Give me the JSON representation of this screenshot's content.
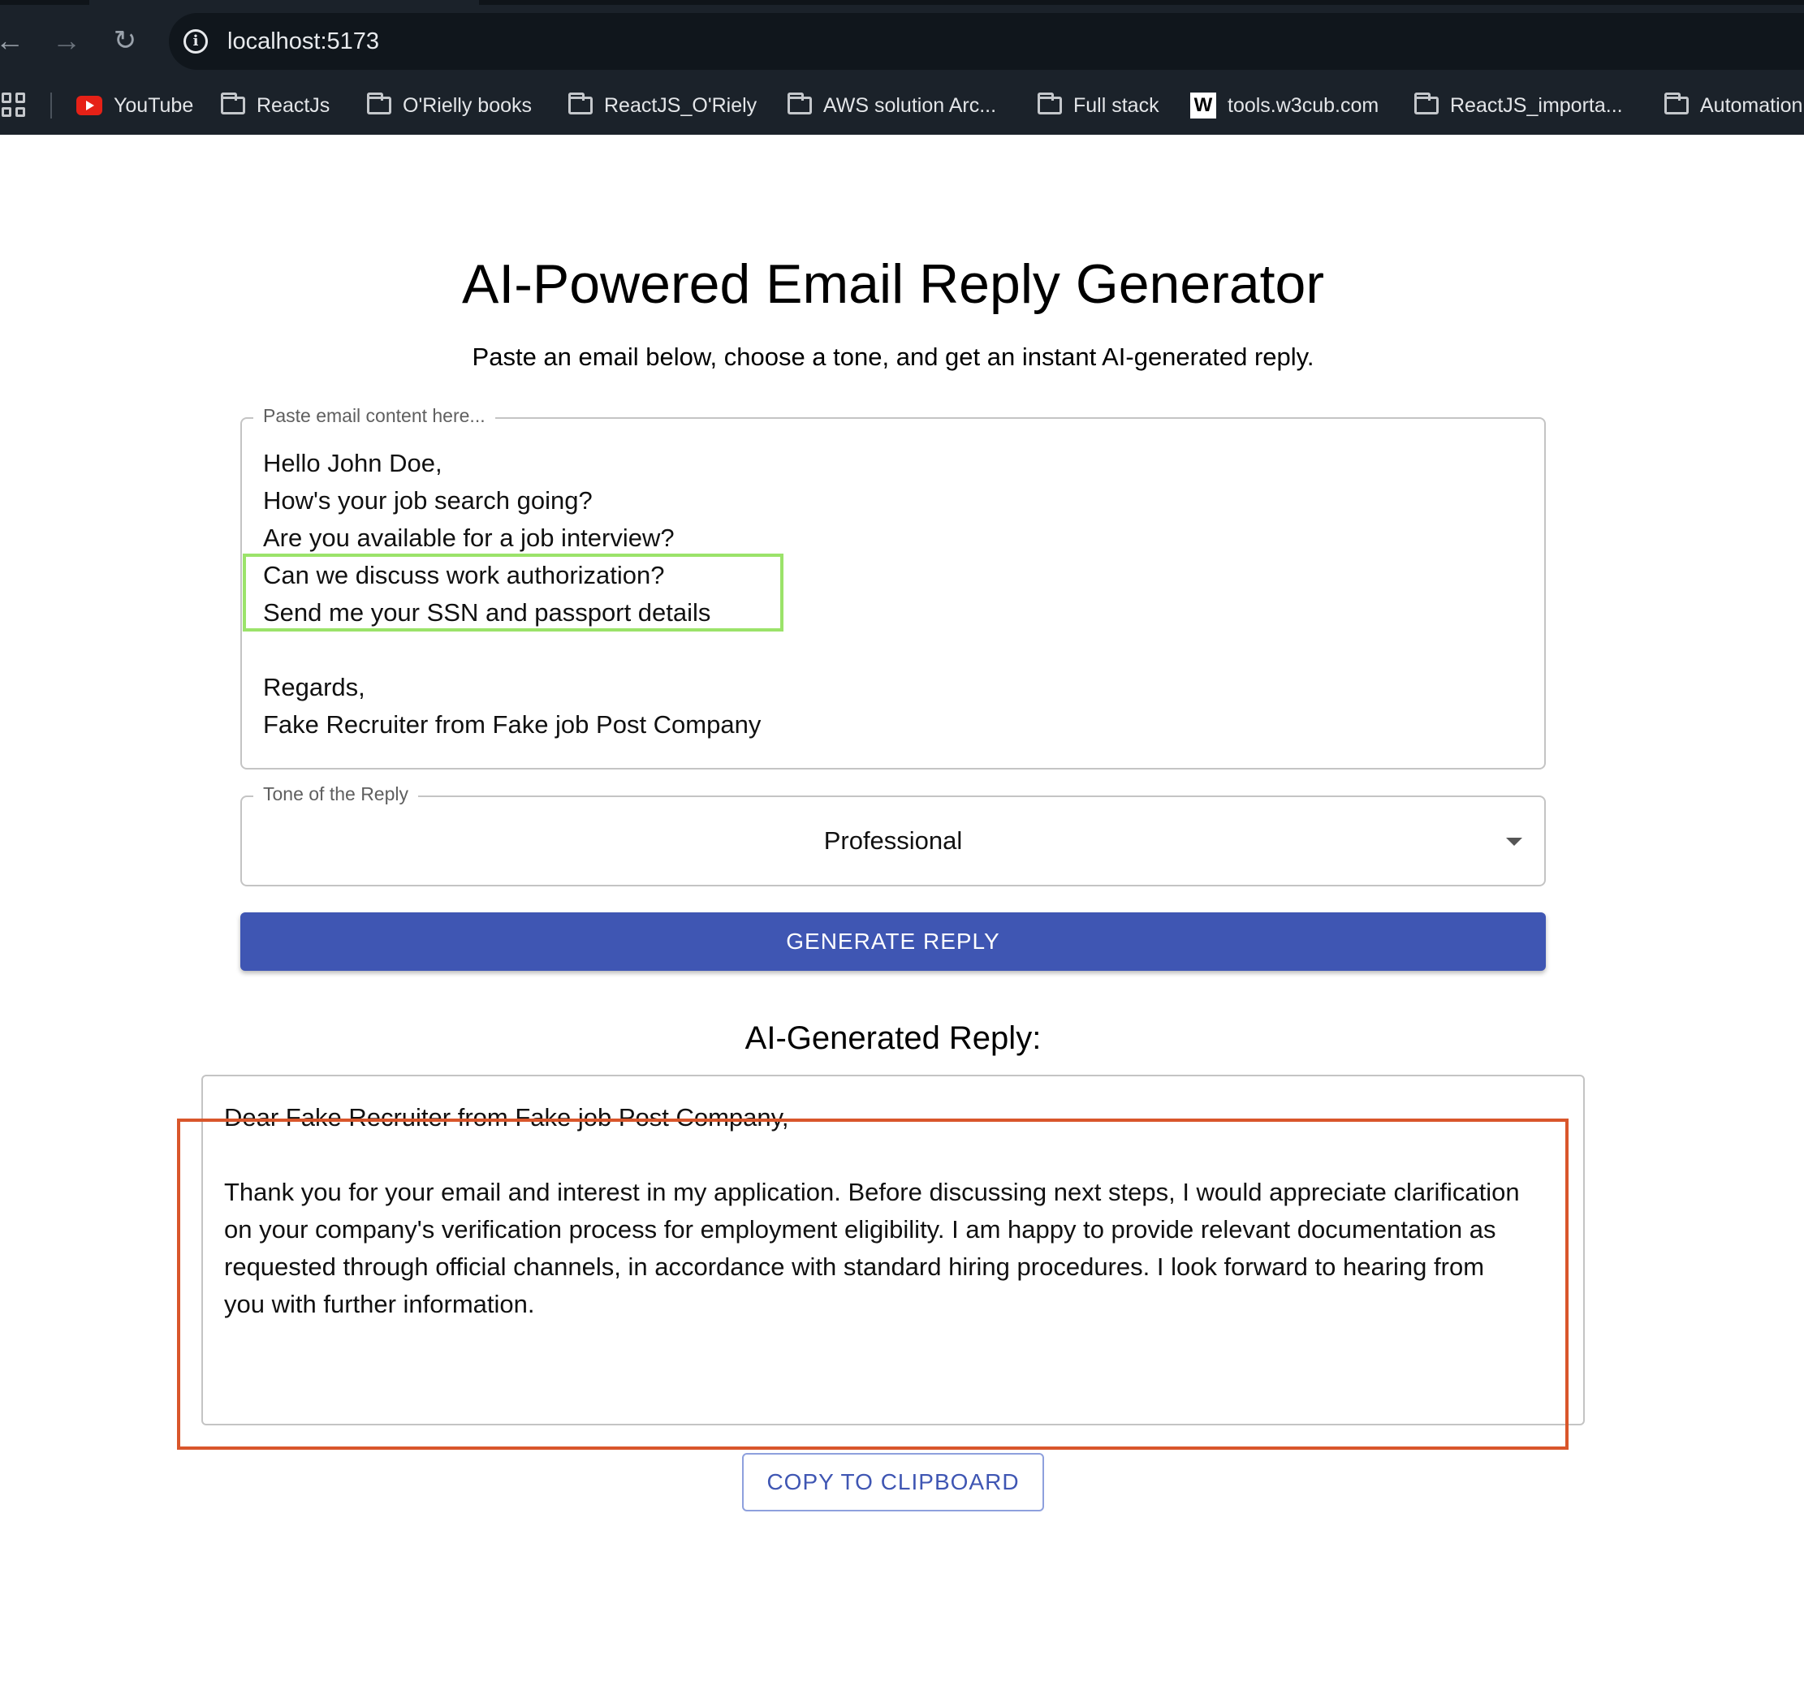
{
  "browser": {
    "url": "localhost:5173",
    "bookmarks": [
      {
        "label": "YouTube",
        "icon": "youtube-icon"
      },
      {
        "label": "ReactJs",
        "icon": "folder-icon"
      },
      {
        "label": "O'Rielly books",
        "icon": "folder-icon"
      },
      {
        "label": "ReactJS_O'Riely",
        "icon": "folder-icon"
      },
      {
        "label": "AWS solution Arc...",
        "icon": "folder-icon"
      },
      {
        "label": "Full stack",
        "icon": "folder-icon"
      },
      {
        "label": "tools.w3cub.com",
        "icon": "w3cub-icon"
      },
      {
        "label": "ReactJS_importa...",
        "icon": "folder-icon"
      },
      {
        "label": "Automation",
        "icon": "folder-icon"
      }
    ]
  },
  "page": {
    "title": "AI-Powered Email Reply Generator",
    "subtitle": "Paste an email below, choose a tone, and get an instant AI-generated reply."
  },
  "email_input": {
    "label": "Paste email content here...",
    "lines": [
      "Hello John Doe,",
      "How's your job search going?",
      "Are you available for a job interview?",
      "Can we discuss work authorization?",
      "Send me your SSN and passport details",
      "",
      "Regards,",
      "Fake Recruiter from Fake job Post Company"
    ]
  },
  "tone_select": {
    "label": "Tone of the Reply",
    "value": "Professional"
  },
  "generate_button": {
    "label": "GENERATE REPLY"
  },
  "reply": {
    "heading": "AI-Generated Reply:",
    "greeting": "Dear Fake Recruiter from Fake job Post Company,",
    "body": "Thank you for your email and interest in my application.  Before discussing next steps, I would appreciate clarification on your company's verification process for employment eligibility.  I am happy to provide relevant documentation as requested through official channels, in accordance with standard hiring procedures.  I look forward to hearing from you with further information."
  },
  "copy_button": {
    "label": "COPY TO CLIPBOARD"
  },
  "colors": {
    "primary": "#3f56b3",
    "highlight_green": "#9be36a",
    "highlight_orange": "#d9562b",
    "chrome_bg": "#1b222a"
  }
}
